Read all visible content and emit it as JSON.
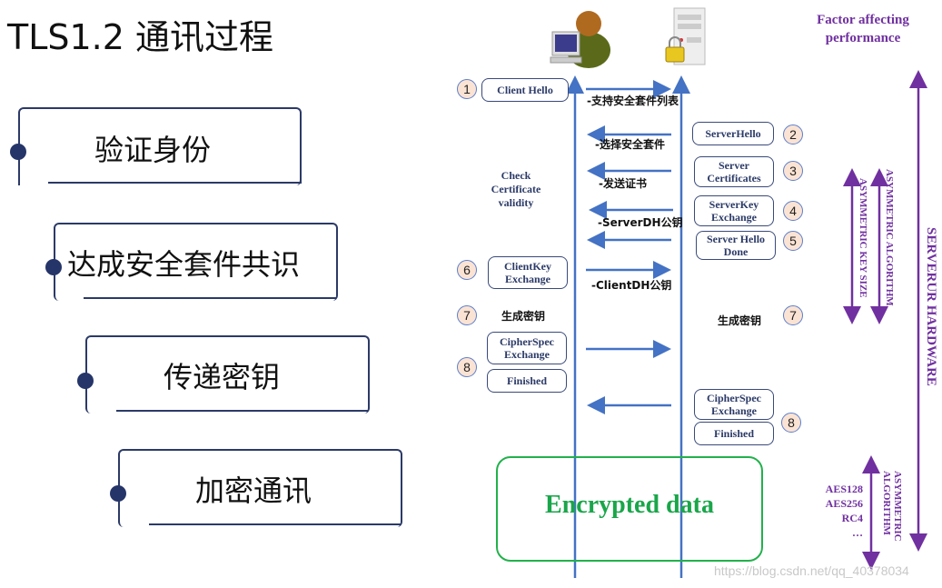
{
  "title": "TLS1.2 通讯过程",
  "steps": [
    {
      "label": "验证身份"
    },
    {
      "label": "达成安全套件共识"
    },
    {
      "label": "传递密钥"
    },
    {
      "label": "加密通讯"
    }
  ],
  "icons": {
    "client": "client-computer-user-icon",
    "server": "locked-server-icon"
  },
  "colors": {
    "step_border": "#2b3a67",
    "lifeline": "#4472c4",
    "purple": "#7030a0",
    "green": "#22b14c",
    "badge_fill": "#fbe3d3"
  },
  "client_messages": {
    "client_hello": "Client Hello",
    "check_cert": "Check Certificate validity",
    "client_key_exchange": "ClientKey Exchange",
    "gen_key": "生成密钥",
    "cipher_spec": "CipherSpec Exchange",
    "finished": "Finished"
  },
  "server_messages": {
    "server_hello": "ServerHello",
    "server_certificates": "Server Certificates",
    "server_key_exchange": "ServerKey Exchange",
    "server_hello_done": "Server Hello Done",
    "gen_key": "生成密钥",
    "cipher_spec": "CipherSpec Exchange",
    "finished": "Finished"
  },
  "arrow_labels": {
    "a1": "-支持安全套件列表",
    "a2": "-选择安全套件",
    "a3": "-发送证书",
    "a4": "-ServerDH公钥",
    "a6": "-ClientDH公钥"
  },
  "badges": {
    "n1": "1",
    "n2": "2",
    "n3": "3",
    "n4": "4",
    "n5": "5",
    "n6": "6",
    "n7": "7",
    "n8": "8"
  },
  "encrypted_data": "Encrypted data",
  "performance": {
    "heading": "Factor affecting performance",
    "asym_key_size": "ASYMMETRIC KEY SIZE",
    "asym_algorithm": "ASYMMETRIC ALGORITHM",
    "server_hardware": "SERVERUR  HARDWARE",
    "sym_algorithm": "ASYMMETRIC ALGORITHM",
    "ciphers": [
      "AES128",
      "AES256",
      "RC4",
      "…"
    ]
  },
  "watermark": "https://blog.csdn.net/qq_40378034"
}
